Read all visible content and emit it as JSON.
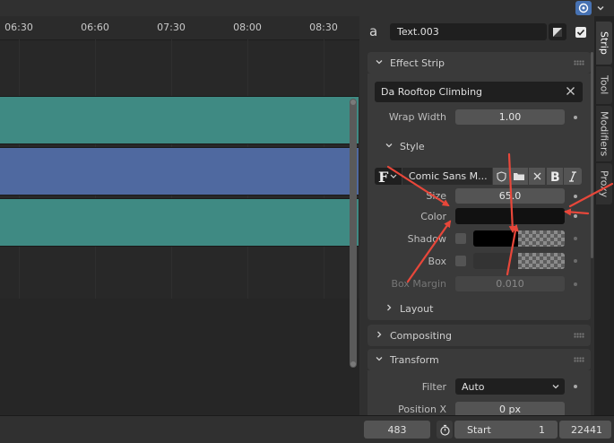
{
  "timeline": {
    "ruler_labels": [
      "06:30",
      "06:60",
      "07:30",
      "08:00",
      "08:30"
    ]
  },
  "properties": {
    "strip_name": "Text.003",
    "sections": {
      "effect_strip": "Effect Strip",
      "style": "Style",
      "layout": "Layout",
      "compositing": "Compositing",
      "transform": "Transform"
    },
    "text_value": "Da Rooftop Climbing",
    "wrap_width": {
      "label": "Wrap Width",
      "value": "1.00"
    },
    "font_name": "Comic Sans M...",
    "size": {
      "label": "Size",
      "value": "65.0"
    },
    "color": {
      "label": "Color",
      "value_hex": "#111111"
    },
    "shadow": {
      "label": "Shadow"
    },
    "box": {
      "label": "Box"
    },
    "box_margin": {
      "label": "Box Margin",
      "value": "0.010"
    },
    "filter": {
      "label": "Filter",
      "value": "Auto"
    },
    "position_x": {
      "label": "Position X",
      "value": "0 px"
    }
  },
  "tabs": [
    "Strip",
    "Tool",
    "Modifiers",
    "Proxy"
  ],
  "playback": {
    "current_frame": "483",
    "start_label": "Start",
    "start_value": "1",
    "end_value": "22441"
  },
  "colors": {
    "strip_green": "#3f8a83",
    "strip_blue": "#4f69a0",
    "annotation_red": "#e8473a",
    "panel_bg": "#303030"
  }
}
